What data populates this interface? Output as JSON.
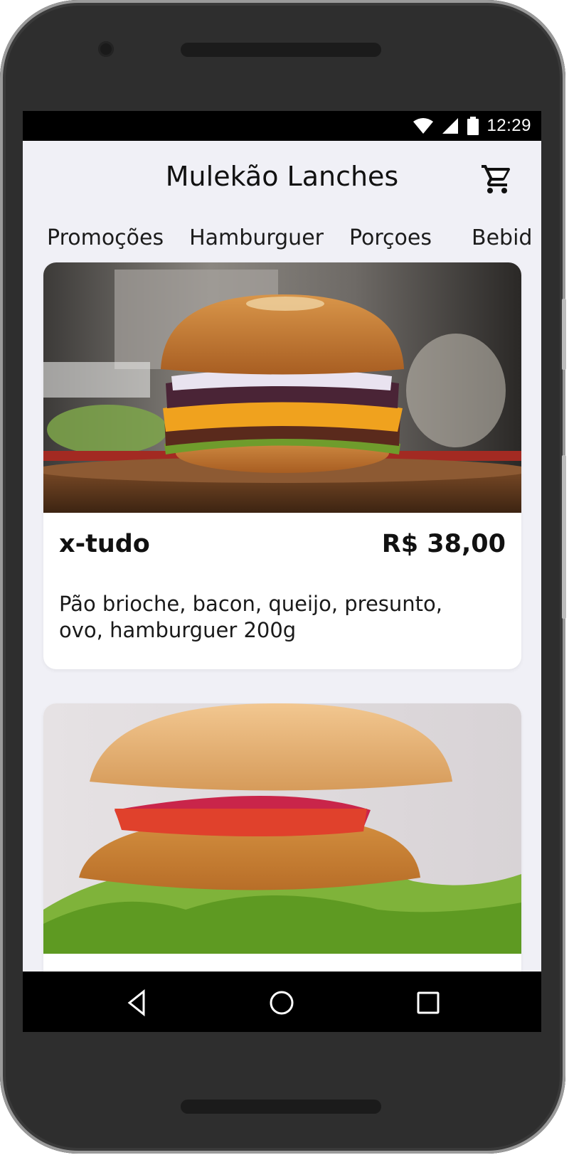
{
  "status_bar": {
    "time": "12:29",
    "icons": [
      "wifi-icon",
      "signal-icon",
      "battery-icon"
    ]
  },
  "header": {
    "title": "Mulekão Lanches",
    "cart_icon": "shopping-cart-icon"
  },
  "categories": [
    {
      "label": "Promoções"
    },
    {
      "label": "Hamburguer"
    },
    {
      "label": "Porçoes"
    },
    {
      "label": "Bebid"
    }
  ],
  "products": [
    {
      "name": "x-tudo",
      "price": "R$ 38,00",
      "description": "Pão brioche, bacon, queijo, presunto, ovo, hamburguer 200g",
      "image": "burger-photo"
    },
    {
      "name": "",
      "price": "",
      "description": "",
      "image": "veggie-burger-photo"
    }
  ],
  "nav_bar": {
    "icons": [
      "back-triangle-icon",
      "home-circle-icon",
      "recents-square-icon"
    ]
  },
  "colors": {
    "screen_background": "#f0f0f6",
    "card_background": "#ffffff",
    "text": "#111111",
    "system_bars": "#000000"
  }
}
